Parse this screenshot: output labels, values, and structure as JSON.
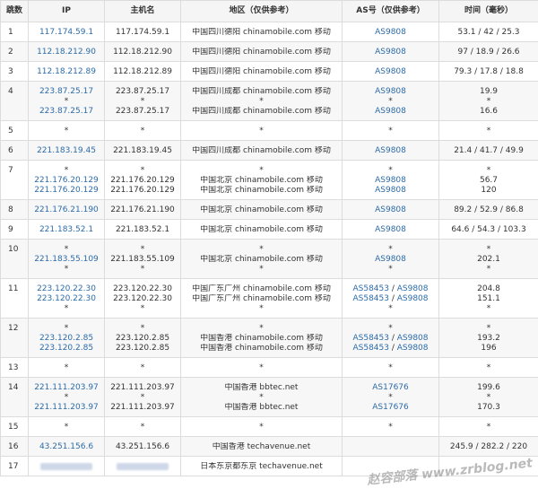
{
  "headers": [
    "跳数",
    "IP",
    "主机名",
    "地区（仅供参考）",
    "AS号（仅供参考）",
    "时间（毫秒）"
  ],
  "rows": [
    {
      "hop": "1",
      "ips": [
        "117.174.59.1"
      ],
      "hosts": [
        "117.174.59.1"
      ],
      "regions": [
        "中国四川德阳 chinamobile.com 移动"
      ],
      "as": [
        [
          "AS9808"
        ]
      ],
      "times": [
        "53.1 / 42 / 25.3"
      ]
    },
    {
      "hop": "2",
      "ips": [
        "112.18.212.90"
      ],
      "hosts": [
        "112.18.212.90"
      ],
      "regions": [
        "中国四川德阳 chinamobile.com 移动"
      ],
      "as": [
        [
          "AS9808"
        ]
      ],
      "times": [
        "97 / 18.9 / 26.6"
      ]
    },
    {
      "hop": "3",
      "ips": [
        "112.18.212.89"
      ],
      "hosts": [
        "112.18.212.89"
      ],
      "regions": [
        "中国四川德阳 chinamobile.com 移动"
      ],
      "as": [
        [
          "AS9808"
        ]
      ],
      "times": [
        "79.3 / 17.8 / 18.8"
      ]
    },
    {
      "hop": "4",
      "ips": [
        "223.87.25.17",
        "*",
        "223.87.25.17"
      ],
      "hosts": [
        "223.87.25.17",
        "*",
        "223.87.25.17"
      ],
      "regions": [
        "中国四川成都 chinamobile.com 移动",
        "*",
        "中国四川成都 chinamobile.com 移动"
      ],
      "as": [
        [
          "AS9808"
        ],
        [
          "*"
        ],
        [
          "AS9808"
        ]
      ],
      "times": [
        "19.9",
        "*",
        "16.6"
      ]
    },
    {
      "hop": "5",
      "ips": [
        "*"
      ],
      "hosts": [
        "*"
      ],
      "regions": [
        "*"
      ],
      "as": [
        [
          "*"
        ]
      ],
      "times": [
        "*"
      ]
    },
    {
      "hop": "6",
      "ips": [
        "221.183.19.45"
      ],
      "hosts": [
        "221.183.19.45"
      ],
      "regions": [
        "中国四川成都 chinamobile.com 移动"
      ],
      "as": [
        [
          "AS9808"
        ]
      ],
      "times": [
        "21.4 / 41.7 / 49.9"
      ]
    },
    {
      "hop": "7",
      "ips": [
        "*",
        "221.176.20.129",
        "221.176.20.129"
      ],
      "hosts": [
        "*",
        "221.176.20.129",
        "221.176.20.129"
      ],
      "regions": [
        "*",
        "中国北京 chinamobile.com 移动",
        "中国北京 chinamobile.com 移动"
      ],
      "as": [
        [
          "*"
        ],
        [
          "AS9808"
        ],
        [
          "AS9808"
        ]
      ],
      "times": [
        "*",
        "56.7",
        "120"
      ]
    },
    {
      "hop": "8",
      "ips": [
        "221.176.21.190"
      ],
      "hosts": [
        "221.176.21.190"
      ],
      "regions": [
        "中国北京 chinamobile.com 移动"
      ],
      "as": [
        [
          "AS9808"
        ]
      ],
      "times": [
        "89.2 / 52.9 / 86.8"
      ]
    },
    {
      "hop": "9",
      "ips": [
        "221.183.52.1"
      ],
      "hosts": [
        "221.183.52.1"
      ],
      "regions": [
        "中国北京 chinamobile.com 移动"
      ],
      "as": [
        [
          "AS9808"
        ]
      ],
      "times": [
        "64.6 / 54.3 / 103.3"
      ]
    },
    {
      "hop": "10",
      "ips": [
        "*",
        "221.183.55.109",
        "*"
      ],
      "hosts": [
        "*",
        "221.183.55.109",
        "*"
      ],
      "regions": [
        "*",
        "中国北京 chinamobile.com 移动",
        "*"
      ],
      "as": [
        [
          "*"
        ],
        [
          "AS9808"
        ],
        [
          "*"
        ]
      ],
      "times": [
        "*",
        "202.1",
        "*"
      ]
    },
    {
      "hop": "11",
      "ips": [
        "223.120.22.30",
        "223.120.22.30",
        "*"
      ],
      "hosts": [
        "223.120.22.30",
        "223.120.22.30",
        "*"
      ],
      "regions": [
        "中国广东广州 chinamobile.com 移动",
        "中国广东广州 chinamobile.com 移动",
        "*"
      ],
      "as": [
        [
          "AS58453",
          "AS9808"
        ],
        [
          "AS58453",
          "AS9808"
        ],
        [
          "*"
        ]
      ],
      "times": [
        "204.8",
        "151.1",
        "*"
      ]
    },
    {
      "hop": "12",
      "ips": [
        "*",
        "223.120.2.85",
        "223.120.2.85"
      ],
      "hosts": [
        "*",
        "223.120.2.85",
        "223.120.2.85"
      ],
      "regions": [
        "*",
        "中国香港 chinamobile.com 移动",
        "中国香港 chinamobile.com 移动"
      ],
      "as": [
        [
          "*"
        ],
        [
          "AS58453",
          "AS9808"
        ],
        [
          "AS58453",
          "AS9808"
        ]
      ],
      "times": [
        "*",
        "193.2",
        "196"
      ]
    },
    {
      "hop": "13",
      "ips": [
        "*"
      ],
      "hosts": [
        "*"
      ],
      "regions": [
        "*"
      ],
      "as": [
        [
          "*"
        ]
      ],
      "times": [
        "*"
      ]
    },
    {
      "hop": "14",
      "ips": [
        "221.111.203.97",
        "*",
        "221.111.203.97"
      ],
      "hosts": [
        "221.111.203.97",
        "*",
        "221.111.203.97"
      ],
      "regions": [
        "中国香港 bbtec.net",
        "*",
        "中国香港 bbtec.net"
      ],
      "as": [
        [
          "AS17676"
        ],
        [
          "*"
        ],
        [
          "AS17676"
        ]
      ],
      "times": [
        "199.6",
        "*",
        "170.3"
      ]
    },
    {
      "hop": "15",
      "ips": [
        "*"
      ],
      "hosts": [
        "*"
      ],
      "regions": [
        "*"
      ],
      "as": [
        [
          "*"
        ]
      ],
      "times": [
        "*"
      ]
    },
    {
      "hop": "16",
      "ips": [
        "43.251.156.6"
      ],
      "hosts": [
        "43.251.156.6"
      ],
      "regions": [
        "中国香港 techavenue.net"
      ],
      "as": [
        [
          ""
        ]
      ],
      "times": [
        "245.9 / 282.2 / 220"
      ]
    },
    {
      "hop": "17",
      "ips": [
        ""
      ],
      "hosts": [
        ""
      ],
      "regions": [
        "日本东京都东京 techavenue.net"
      ],
      "as": [
        [
          ""
        ]
      ],
      "times": [
        ""
      ]
    }
  ],
  "as_separator": " / ",
  "watermark": "赵容部落 www.zrblog.net",
  "colors": {
    "link": "#2c6ba8",
    "header_bg": "#f5f5f5",
    "stripe_bg": "#f7f7f7",
    "border": "#dcdcdc"
  }
}
